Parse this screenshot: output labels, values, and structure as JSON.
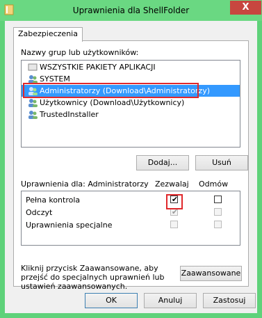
{
  "window": {
    "title": "Uprawnienia dla ShellFolder",
    "close_label": "X"
  },
  "tabs": [
    {
      "label": "Zabezpieczenia"
    }
  ],
  "groups": {
    "label": "Nazwy grup lub użytkowników:",
    "items": [
      {
        "label": "WSZYSTKIE PAKIETY APLIKACJI",
        "icon": "app-packages-icon"
      },
      {
        "label": "SYSTEM",
        "icon": "user-group-icon"
      },
      {
        "label": "Administratorzy (Download\\Administratorzy)",
        "icon": "user-group-icon",
        "selected": true
      },
      {
        "label": "Użytkownicy (Download\\Użytkownicy)",
        "icon": "user-group-icon"
      },
      {
        "label": "TrustedInstaller",
        "icon": "user-group-icon"
      }
    ]
  },
  "buttons": {
    "add": "Dodaj...",
    "remove": "Usuń",
    "advanced": "Zaawansowane",
    "ok": "OK",
    "cancel": "Anuluj",
    "apply": "Zastosuj"
  },
  "permissions": {
    "header_label": "Uprawnienia dla: Administratorzy",
    "allow_header": "Zezwalaj",
    "deny_header": "Odmów",
    "rows": [
      {
        "name": "Pełna kontrola",
        "allow": true,
        "deny": false,
        "allow_enabled": true,
        "deny_enabled": true
      },
      {
        "name": "Odczyt",
        "allow": true,
        "deny": false,
        "allow_enabled": false,
        "deny_enabled": false
      },
      {
        "name": "Uprawnienia specjalne",
        "allow": false,
        "deny": false,
        "allow_enabled": false,
        "deny_enabled": false
      }
    ]
  },
  "advanced_text": "Kliknij przycisk Zaawansowane, aby przejść do specjalnych uprawnień lub ustawień zaawansowanych.",
  "colors": {
    "highlight": "#e0282b",
    "selection": "#3399ff",
    "frame": "#5fd27a"
  }
}
